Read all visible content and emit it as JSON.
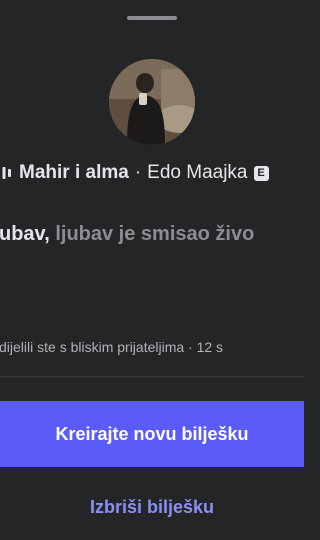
{
  "note": {
    "song_title": "Mahir i alma",
    "separator": "·",
    "artist": "Edo Maajka",
    "explicit_badge": "E",
    "lyric_active": "ubav,",
    "lyric_rest": "ljubav je smisao živo",
    "meta": "dijelili ste s bliskim prijateljima · 12 s"
  },
  "actions": {
    "create_label": "Kreirajte novu bilješku",
    "delete_label": "Izbriši bilješku"
  },
  "icons": {
    "music": "music-bars-icon",
    "avatar": "user-photo"
  },
  "colors": {
    "background": "#242526",
    "primary_button": "#5b5cf7",
    "delete_text": "#8b8ff5",
    "muted_text": "#8a8d91"
  }
}
